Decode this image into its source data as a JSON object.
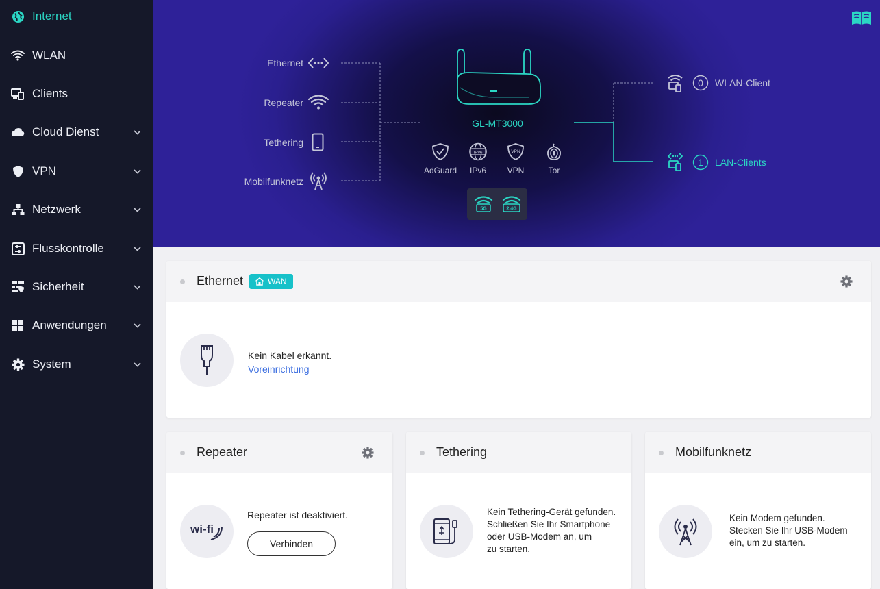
{
  "sidebar": {
    "items": [
      {
        "label": "Internet",
        "icon": "globe-icon",
        "active": true,
        "expandable": false
      },
      {
        "label": "WLAN",
        "icon": "wifi-icon",
        "active": false,
        "expandable": false
      },
      {
        "label": "Clients",
        "icon": "devices-icon",
        "active": false,
        "expandable": false
      },
      {
        "label": "Cloud Dienst",
        "icon": "cloud-icon",
        "active": false,
        "expandable": true
      },
      {
        "label": "VPN",
        "icon": "shield-icon",
        "active": false,
        "expandable": true
      },
      {
        "label": "Netzwerk",
        "icon": "network-icon",
        "active": false,
        "expandable": true
      },
      {
        "label": "Flusskontrolle",
        "icon": "flow-control-icon",
        "active": false,
        "expandable": true
      },
      {
        "label": "Sicherheit",
        "icon": "firewall-icon",
        "active": false,
        "expandable": true
      },
      {
        "label": "Anwendungen",
        "icon": "apps-icon",
        "active": false,
        "expandable": true
      },
      {
        "label": "System",
        "icon": "gear-icon",
        "active": false,
        "expandable": true
      }
    ]
  },
  "topology": {
    "sources": [
      {
        "label": "Ethernet",
        "icon": "ethernet-icon"
      },
      {
        "label": "Repeater",
        "icon": "wifi-icon"
      },
      {
        "label": "Tethering",
        "icon": "phone-icon"
      },
      {
        "label": "Mobilfunknetz",
        "icon": "cell-tower-icon"
      }
    ],
    "router_name": "GL-MT3000",
    "features": [
      {
        "label": "AdGuard",
        "icon": "adguard-shield-icon"
      },
      {
        "label": "IPv6",
        "icon": "ipv6-globe-icon"
      },
      {
        "label": "VPN",
        "icon": "vpn-shield-icon"
      },
      {
        "label": "Tor",
        "icon": "tor-onion-icon"
      }
    ],
    "bands": [
      {
        "label": "5G",
        "icon": "wifi-5g-icon"
      },
      {
        "label": "2.4G",
        "icon": "wifi-2g-icon"
      }
    ],
    "clients": [
      {
        "count": "0",
        "label": "WLAN-Client",
        "active": false
      },
      {
        "count": "1",
        "label": "LAN-Clients",
        "active": true
      }
    ]
  },
  "ethernet_card": {
    "title": "Ethernet",
    "badge": "WAN",
    "message": "Kein Kabel erkannt.",
    "link": "Voreinrichtung"
  },
  "repeater_card": {
    "title": "Repeater",
    "message": "Repeater ist deaktiviert.",
    "button": "Verbinden",
    "icon_text": "wi-fi"
  },
  "tethering_card": {
    "title": "Tethering",
    "lines": [
      "Kein Tethering-Gerät gefunden.",
      "Schließen Sie Ihr Smartphone",
      "oder USB-Modem an, um",
      "zu starten."
    ]
  },
  "mobile_card": {
    "title": "Mobilfunknetz",
    "lines": [
      "Kein Modem gefunden.",
      "Stecken Sie Ihr USB-Modem",
      "ein, um zu starten."
    ]
  },
  "colors": {
    "accent": "#2bd6c4",
    "sidebar_bg": "#151829",
    "hero_bg": "#2e2198",
    "link": "#3d6fe0",
    "badge": "#17c1c9"
  }
}
